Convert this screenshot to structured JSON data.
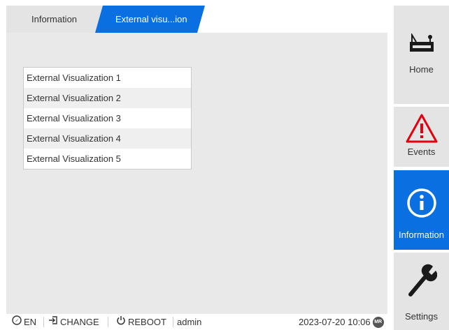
{
  "tabs": {
    "information": "Information",
    "external": "External visu...ion"
  },
  "list": {
    "items": [
      "External Visualization 1",
      "External Visualization 2",
      "External Visualization 3",
      "External Visualization 4",
      "External Visualization 5"
    ]
  },
  "statusbar": {
    "language": "EN",
    "change": "CHANGE",
    "reboot": "REBOOT",
    "user": "admin",
    "datetime": "2023-07-20 10:06",
    "mr_icon_text": "MR"
  },
  "sidebar": {
    "home": "Home",
    "events": "Events",
    "information": "Information",
    "settings": "Settings"
  },
  "colors": {
    "accent": "#0a6fe0",
    "alarm": "#e3000f"
  }
}
